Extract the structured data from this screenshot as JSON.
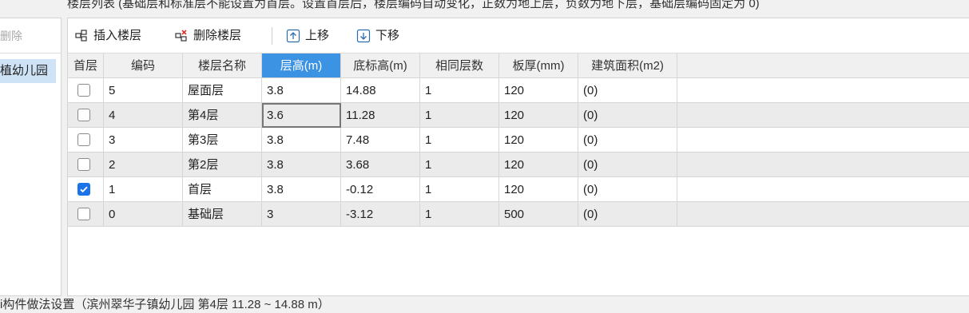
{
  "header_caption": "楼层列表 (基础层和标准层不能设置为首层。设置首层后，楼层编码自动变化，正数为地上层，负数为地下层，基础层编码固定为 0)",
  "left_panel": {
    "delete_label": "删除",
    "selected_item": "植幼儿园"
  },
  "toolbar": {
    "insert_floor": "插入楼层",
    "delete_floor": "删除楼层",
    "move_up": "上移",
    "move_down": "下移"
  },
  "columns": [
    "首层",
    "编码",
    "楼层名称",
    "层高(m)",
    "底标高(m)",
    "相同层数",
    "板厚(mm)",
    "建筑面积(m2)"
  ],
  "active_column": "层高(m)",
  "rows": [
    {
      "first": false,
      "code": "5",
      "name": "屋面层",
      "height": "3.8",
      "bottom_elev": "14.88",
      "same_count": "1",
      "slab": "120",
      "area": "(0)"
    },
    {
      "first": false,
      "code": "4",
      "name": "第4层",
      "height": "3.6",
      "bottom_elev": "11.28",
      "same_count": "1",
      "slab": "120",
      "area": "(0)"
    },
    {
      "first": false,
      "code": "3",
      "name": "第3层",
      "height": "3.8",
      "bottom_elev": "7.48",
      "same_count": "1",
      "slab": "120",
      "area": "(0)"
    },
    {
      "first": false,
      "code": "2",
      "name": "第2层",
      "height": "3.8",
      "bottom_elev": "3.68",
      "same_count": "1",
      "slab": "120",
      "area": "(0)"
    },
    {
      "first": true,
      "code": "1",
      "name": "首层",
      "height": "3.8",
      "bottom_elev": "-0.12",
      "same_count": "1",
      "slab": "120",
      "area": "(0)"
    },
    {
      "first": false,
      "code": "0",
      "name": "基础层",
      "height": "3",
      "bottom_elev": "-3.12",
      "same_count": "1",
      "slab": "500",
      "area": "(0)"
    }
  ],
  "footer_caption": "i构件做法设置（滨州翠华子镇幼儿园  第4层  11.28 ~ 14.88 m）",
  "colors": {
    "accent": "#3c92e3",
    "selection": "#cfe3f6",
    "checkbox": "#1a73e8"
  }
}
